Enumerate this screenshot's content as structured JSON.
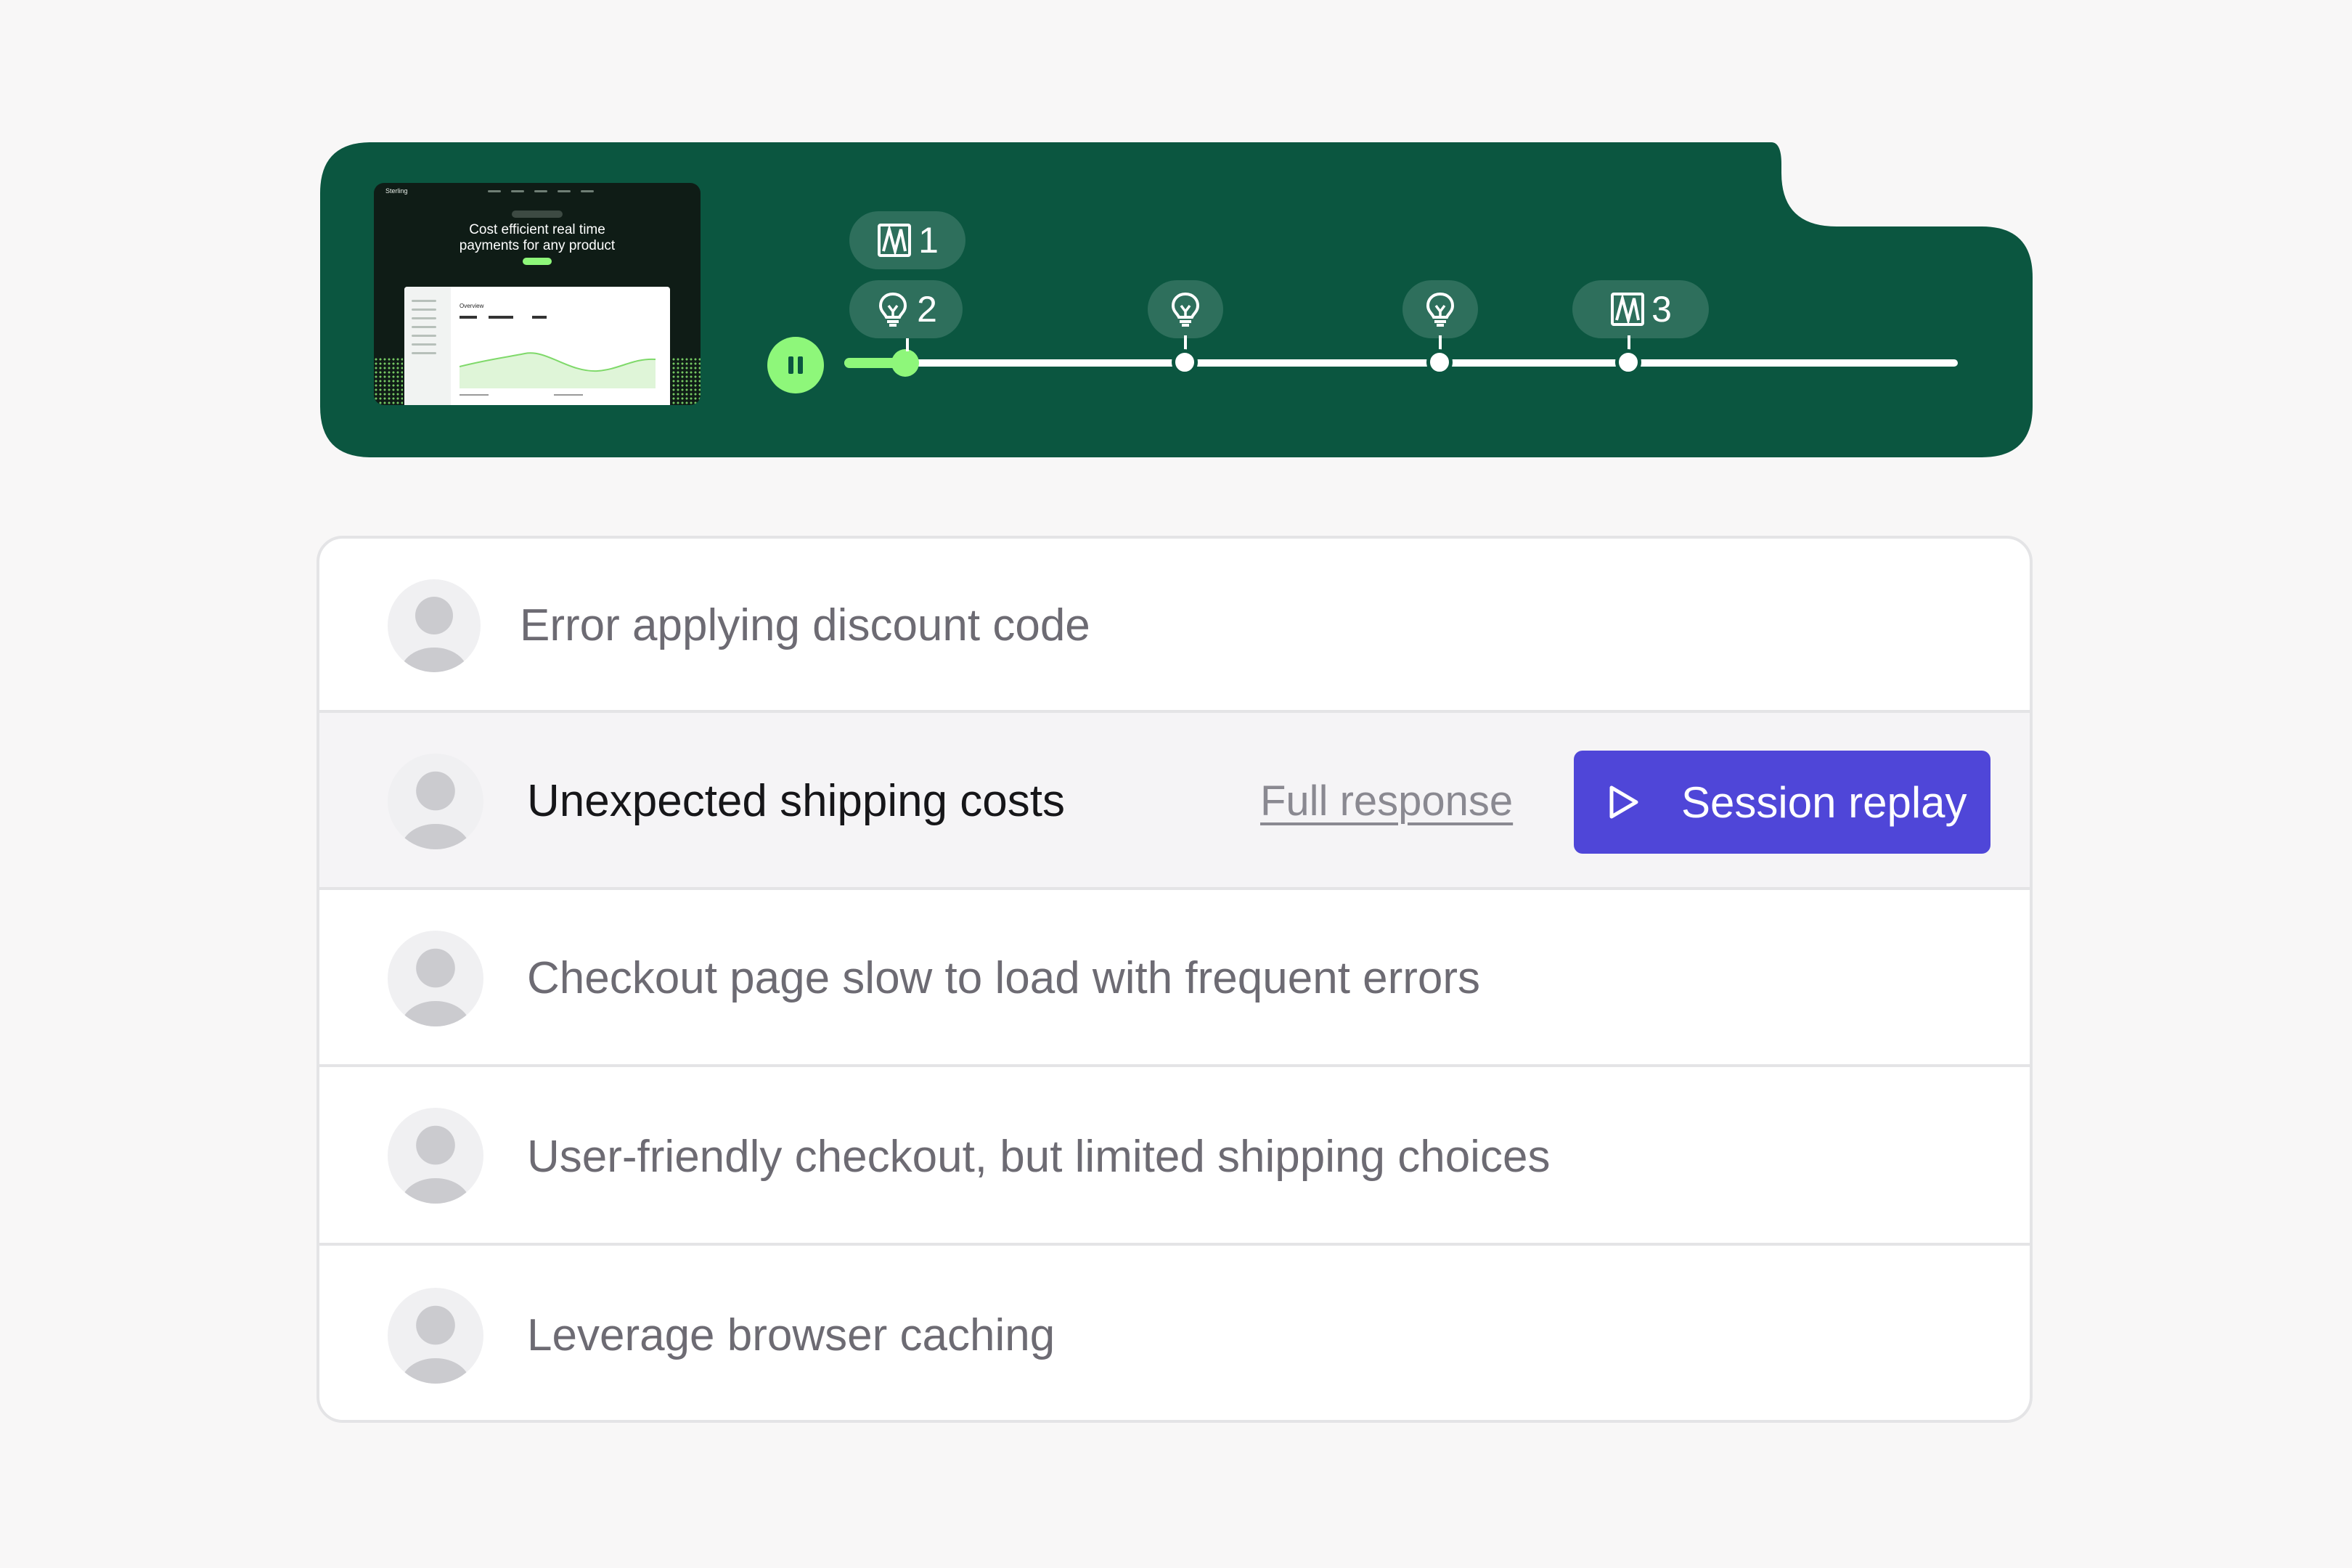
{
  "colors": {
    "player_bg": "#0b5640",
    "accent_green": "#8ef77a",
    "pill_bg": "#2e6f5c",
    "primary_button": "#4f46d8",
    "page_bg": "#f8f7f7"
  },
  "player": {
    "thumbnail": {
      "brand": "Sterling",
      "headline_line1": "Cost efficient real time",
      "headline_line2": "payments for any product",
      "dashboard_title": "Overview"
    },
    "pause_icon": "pause-icon",
    "progress_fraction": 0.055,
    "markers": [
      {
        "type": "bookmark",
        "count": "1"
      },
      {
        "type": "insight",
        "count": "2"
      },
      {
        "type": "insight",
        "count": ""
      },
      {
        "type": "insight",
        "count": ""
      },
      {
        "type": "bookmark",
        "count": "3"
      }
    ]
  },
  "feedback": {
    "items": [
      {
        "title": "Error applying discount code"
      },
      {
        "title": "Unexpected shipping costs",
        "link_label": "Full response",
        "button_label": "Session replay",
        "button_icon": "play-icon"
      },
      {
        "title": "Checkout page slow to load with frequent errors"
      },
      {
        "title": "User-friendly checkout, but limited shipping choices"
      },
      {
        "title": "Leverage browser caching"
      }
    ]
  }
}
